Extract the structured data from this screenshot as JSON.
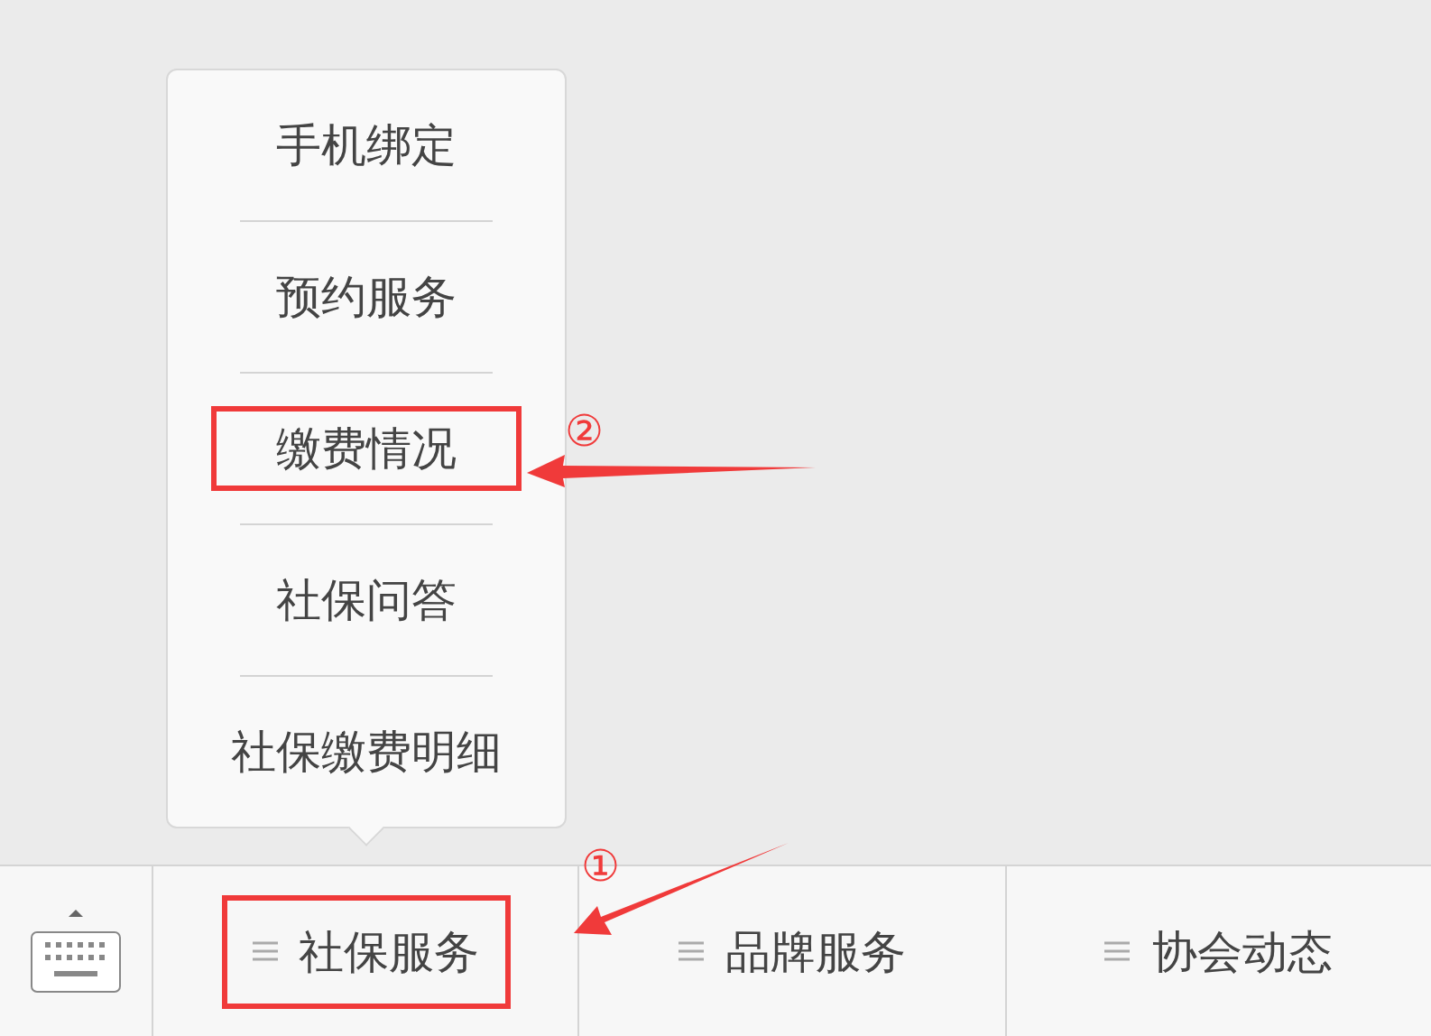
{
  "popup_menu": {
    "items": [
      {
        "label": "手机绑定",
        "highlighted": false
      },
      {
        "label": "预约服务",
        "highlighted": false
      },
      {
        "label": "缴费情况",
        "highlighted": true
      },
      {
        "label": "社保问答",
        "highlighted": false
      },
      {
        "label": "社保缴费明细",
        "highlighted": false
      }
    ]
  },
  "menu_bar": {
    "tabs": [
      {
        "label": "社保服务",
        "highlighted": true
      },
      {
        "label": "品牌服务",
        "highlighted": false
      },
      {
        "label": "协会动态",
        "highlighted": false
      }
    ]
  },
  "annotations": [
    {
      "label": "②"
    },
    {
      "label": "①"
    }
  ]
}
